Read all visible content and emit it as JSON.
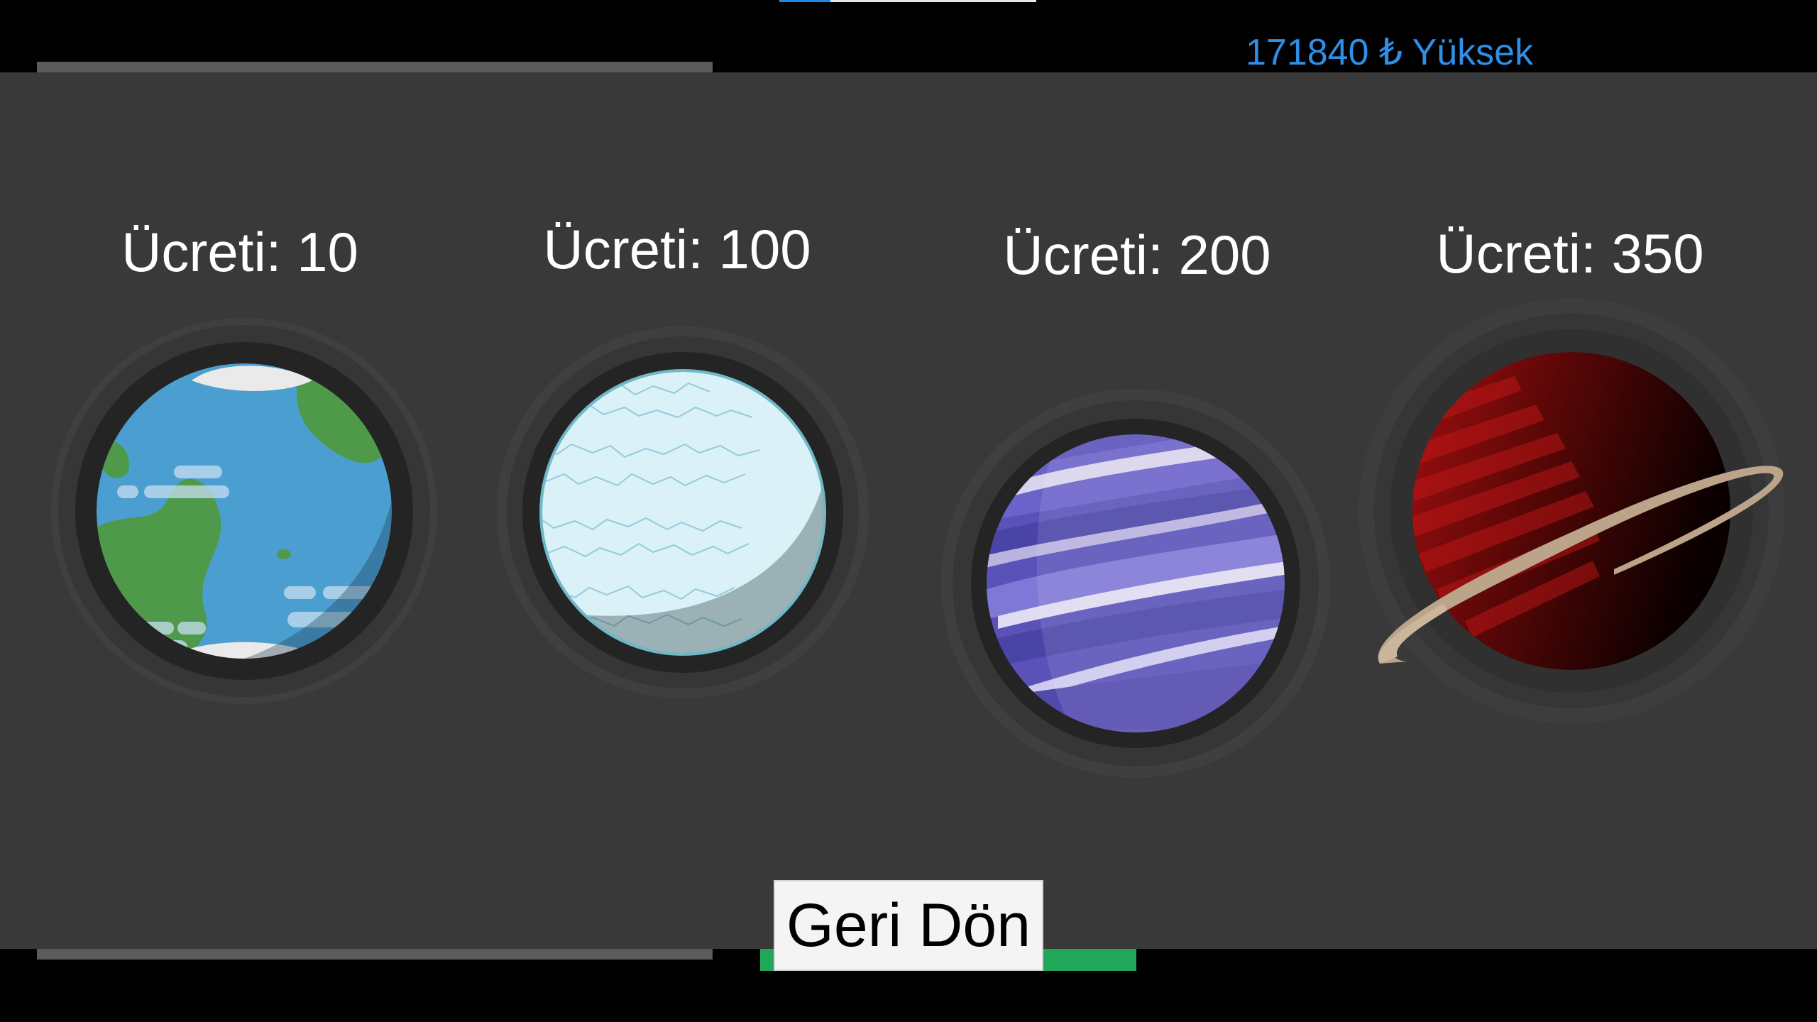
{
  "header": {
    "score": "171840 ₺ Yüksek"
  },
  "background": {
    "green_button_label": "▶"
  },
  "shop": {
    "planets": [
      {
        "id": "earth",
        "price_label": "Ücreti: 10",
        "icon": "earth-planet-icon"
      },
      {
        "id": "ice",
        "price_label": "Ücreti: 100",
        "icon": "ice-planet-icon"
      },
      {
        "id": "gas-giant",
        "price_label": "Ücreti: 200",
        "icon": "purple-gas-planet-icon"
      },
      {
        "id": "ringed",
        "price_label": "Ücreti: 350",
        "icon": "ringed-red-planet-icon"
      }
    ],
    "back_button_label": "Geri Dön"
  },
  "colors": {
    "modal_background": "#393939",
    "score_text": "#2f8fe6",
    "accent_green": "#20a75a"
  }
}
